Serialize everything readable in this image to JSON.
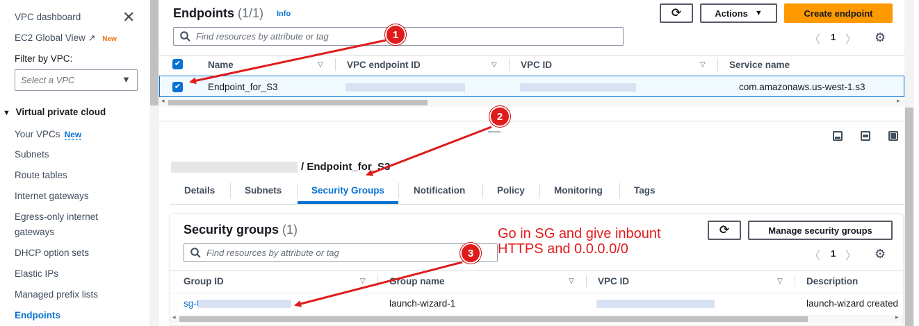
{
  "sidebar": {
    "dashboard": "VPC dashboard",
    "ec2_global": "EC2 Global View",
    "ec2_new": "New",
    "filter_label": "Filter by VPC:",
    "select_placeholder": "Select a VPC",
    "section": "Virtual private cloud",
    "items": [
      {
        "label": "Your VPCs",
        "badge": "New"
      },
      {
        "label": "Subnets"
      },
      {
        "label": "Route tables"
      },
      {
        "label": "Internet gateways"
      },
      {
        "label": "Egress-only internet"
      },
      {
        "label": "gateways"
      },
      {
        "label": "DHCP option sets"
      },
      {
        "label": "Elastic IPs"
      },
      {
        "label": "Managed prefix lists"
      },
      {
        "label": "Endpoints"
      }
    ]
  },
  "endpoints": {
    "title": "Endpoints",
    "count": "(1/1)",
    "info": "Info",
    "actions": "Actions",
    "create": "Create endpoint",
    "search_placeholder": "Find resources by attribute or tag",
    "page": "1",
    "columns": [
      "Name",
      "VPC endpoint ID",
      "VPC ID",
      "Service name"
    ],
    "row": {
      "name": "Endpoint_for_S3",
      "service": "com.amazonaws.us-west-1.s3"
    }
  },
  "details": {
    "breadcrumb": "/ Endpoint_for_S3",
    "tabs": [
      "Details",
      "Subnets",
      "Security Groups",
      "Notification",
      "Policy",
      "Monitoring",
      "Tags"
    ],
    "active_tab": "Security Groups"
  },
  "security_groups": {
    "title": "Security groups",
    "count": "(1)",
    "manage": "Manage security groups",
    "search_placeholder": "Find resources by attribute or tag",
    "page": "1",
    "columns": [
      "Group ID",
      "Group name",
      "VPC ID",
      "Description"
    ],
    "row": {
      "group_id": "sg-0",
      "group_name": "launch-wizard-1",
      "description": "launch-wizard created"
    }
  },
  "annotation": {
    "note_line1": "Go in SG and give inbount",
    "note_line2": "HTTPS and 0.0.0.0/0",
    "markers": [
      "1",
      "2",
      "3"
    ],
    "color": "#e01b1b"
  }
}
